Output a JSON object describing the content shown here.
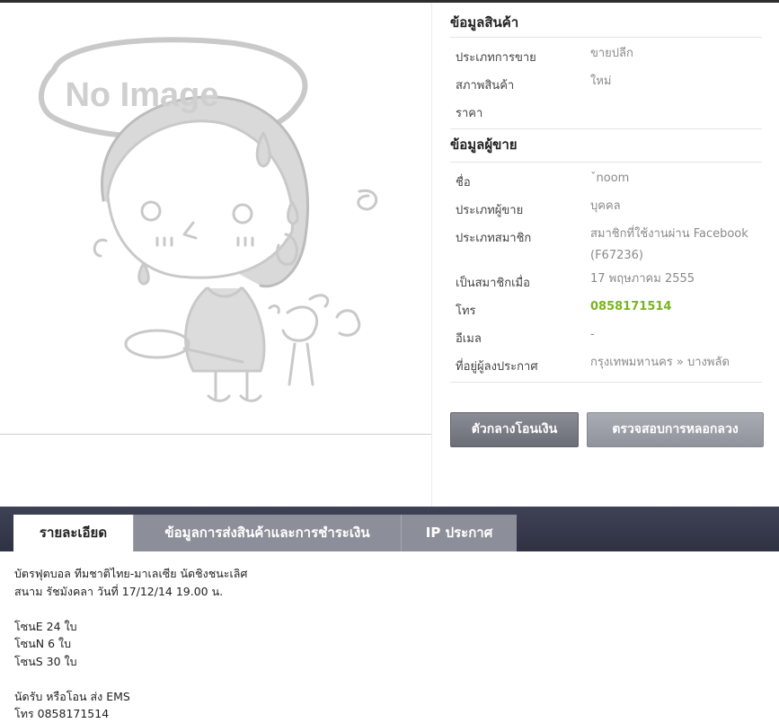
{
  "image": {
    "placeholder_text": "No Image"
  },
  "product_info": {
    "title": "ข้อมูลสินค้า",
    "rows": [
      {
        "label": "ประเภทการขาย",
        "value": "ขายปลีก"
      },
      {
        "label": "สภาพสินค้า",
        "value": "ใหม่"
      },
      {
        "label": "ราคา",
        "value": ""
      }
    ]
  },
  "seller_info": {
    "title": "ข้อมูลผู้ขาย",
    "name_label": "ชื่อ",
    "name_value": "ˇnoom",
    "type_label": "ประเภทผู้ขาย",
    "type_value": "บุคคล",
    "member_type_label": "ประเภทสมาชิก",
    "member_type_value": "สมาชิกที่ใช้งานผ่าน Facebook (F67236)",
    "member_since_label": "เป็นสมาชิกเมื่อ",
    "member_since_value": "17 พฤษภาคม 2555",
    "phone_label": "โทร",
    "phone_value": "0858171514",
    "email_label": "อีเมล",
    "email_value": "-",
    "location_label": "ที่อยู่ผู้ลงประกาศ",
    "location_value": "กรุงเทพมหานคร » บางพลัด"
  },
  "buttons": {
    "escrow": "ตัวกลางโอนเงิน",
    "fraud_check": "ตรวจสอบการหลอกลวง"
  },
  "tabs": [
    {
      "label": "รายละเอียด",
      "active": true
    },
    {
      "label": "ข้อมูลการส่งสินค้าและการชำระเงิน",
      "active": false
    },
    {
      "label": "IP ประกาศ",
      "active": false
    }
  ],
  "description": {
    "lines": [
      "บัตรฟุตบอล ทีมชาติไทย-มาเลเซีย นัดชิงชนะเลิศ",
      "สนาม รัชมังคลา วันที่ 17/12/14 19.00 น.",
      "",
      "โซนE 24 ใบ",
      "โซนN 6 ใบ",
      "โซนS 30 ใบ",
      "",
      "นัดรับ หรือโอน ส่ง EMS",
      "โทร 0858171514"
    ]
  },
  "colors": {
    "phone_green": "#7ab51d",
    "tabbar_dark": "#3f4256",
    "tab_inactive": "#8c8f99",
    "button_dark": "#6b6e77"
  }
}
